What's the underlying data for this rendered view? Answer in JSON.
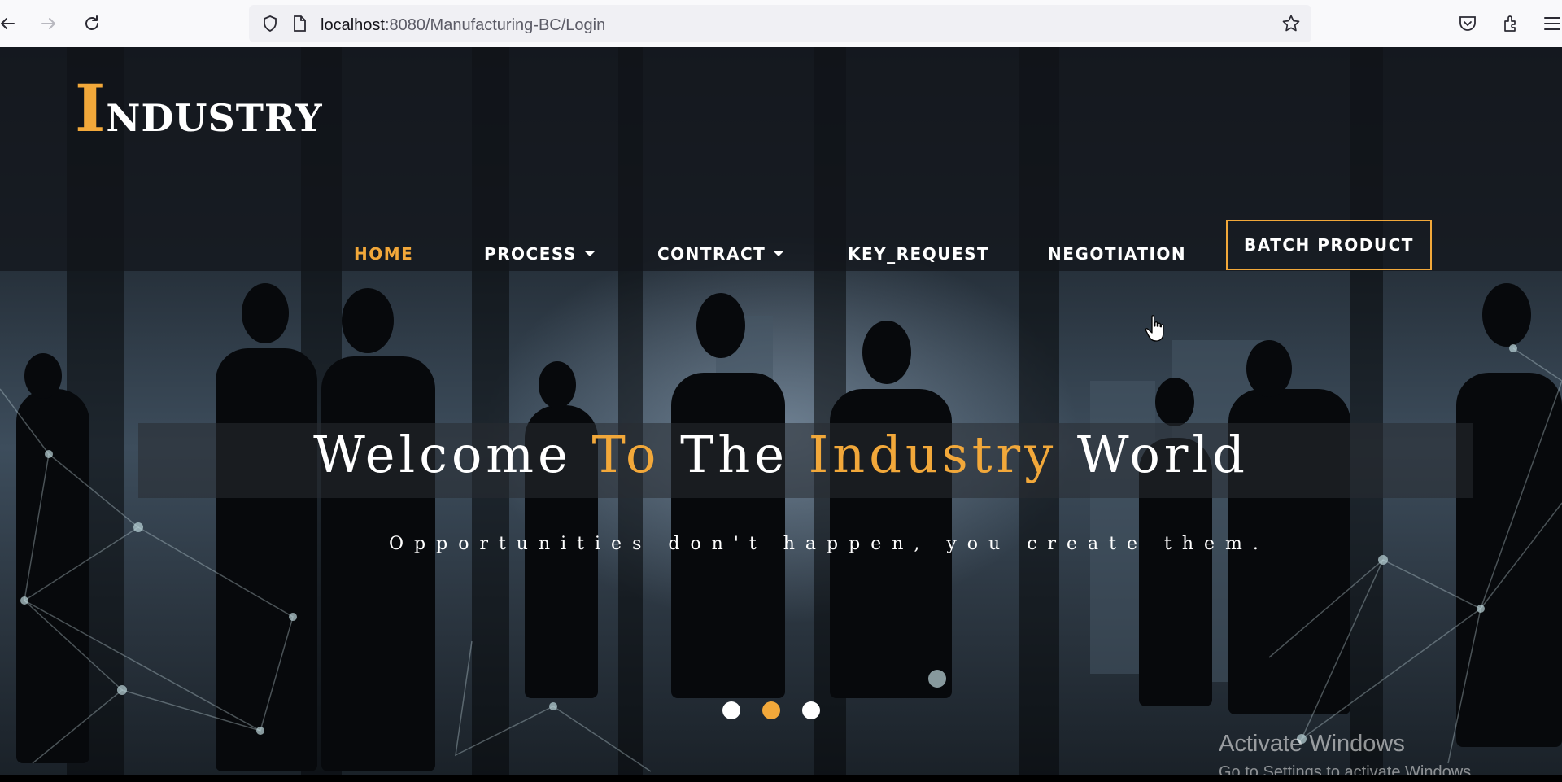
{
  "browser": {
    "url_host": "localhost",
    "url_path": ":8080/Manufacturing-BC/Login",
    "icons": [
      "back-icon",
      "forward-icon",
      "reload-icon",
      "shield-icon",
      "page-icon",
      "star-icon",
      "pocket-icon",
      "extensions-icon",
      "menu-icon"
    ]
  },
  "site": {
    "logo_initial": "I",
    "logo_rest": "NDUSTRY"
  },
  "menu": {
    "home": "HOME",
    "process": "PROCESS",
    "contract": "CONTRACT",
    "key_request": "KEY_REQUEST",
    "negotiation": "NEGOTIATION",
    "batch_product": "BATCH PRODUCT"
  },
  "hero": {
    "title_1": "Welcome ",
    "title_2": "To",
    "title_3": " The ",
    "title_4": "Industry",
    "title_5": " World",
    "subtitle": "Opportunities don't happen, you create them."
  },
  "carousel": {
    "active_index": 1,
    "count": 3
  },
  "watermark": {
    "line1": "Activate Windows",
    "line2": "Go to Settings to activate Windows."
  },
  "colors": {
    "accent": "#f2a83a",
    "text": "#ffffff"
  }
}
